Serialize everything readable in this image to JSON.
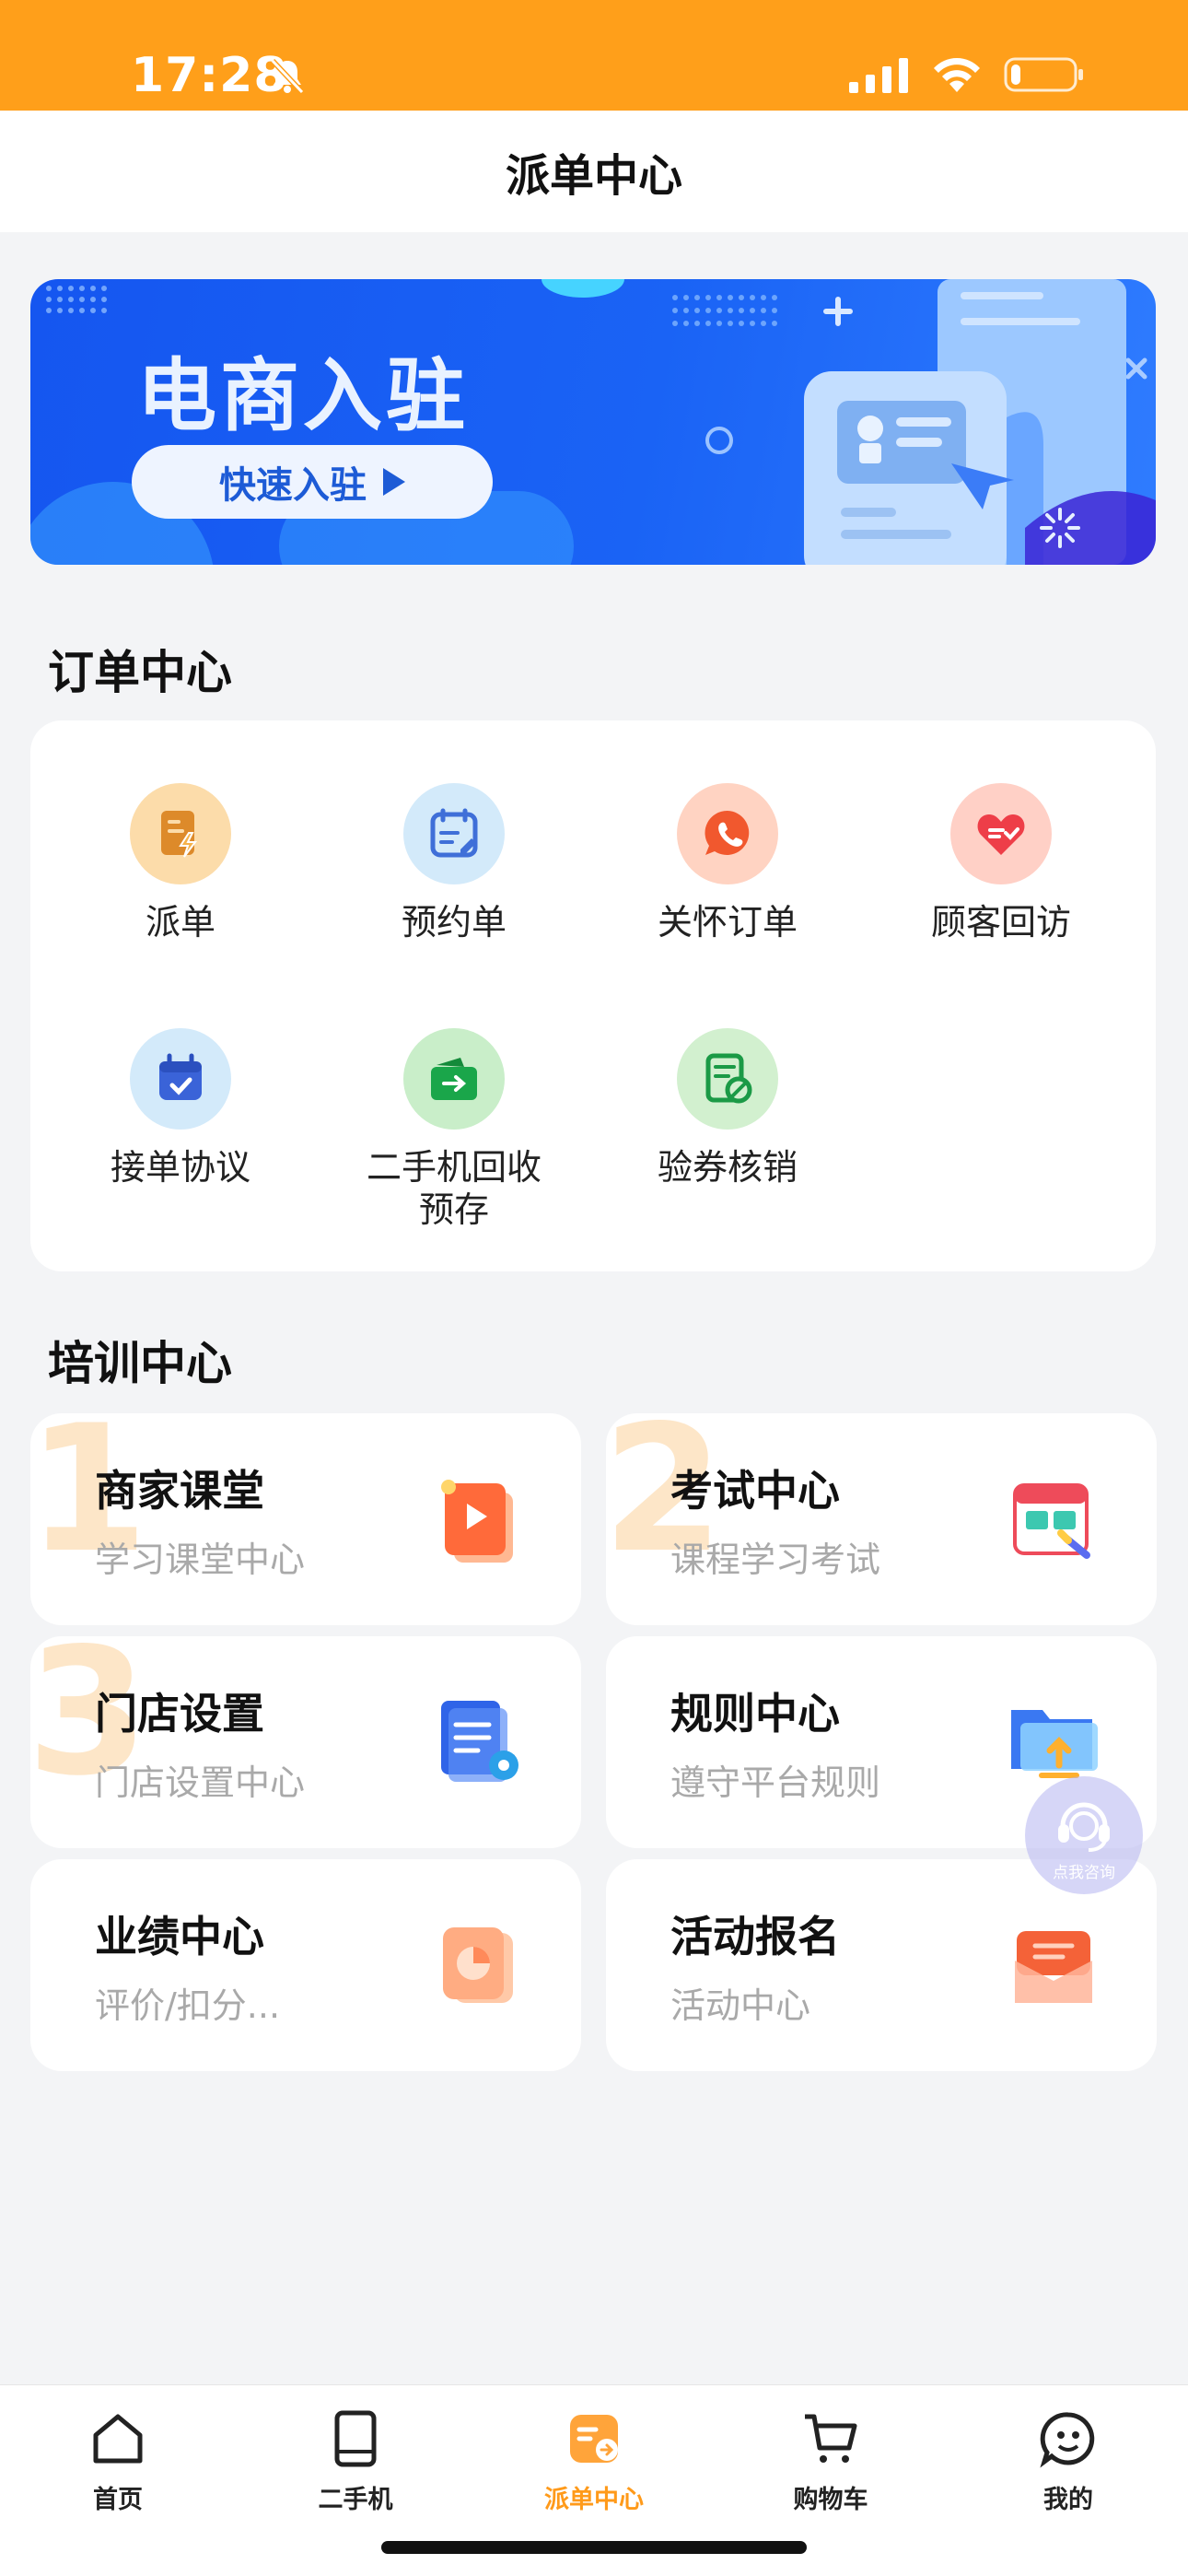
{
  "status_bar": {
    "time": "17:28",
    "battery_level": 0.15
  },
  "nav": {
    "title": "派单中心"
  },
  "banner": {
    "title": "电商入驻",
    "button_label": "快速入驻"
  },
  "order_center": {
    "title": "订单中心",
    "items": [
      {
        "label": "派单",
        "icon": "dispatch-icon",
        "color": "#fbd9a6"
      },
      {
        "label": "预约单",
        "icon": "appointment-calendar-icon",
        "color": "#d6ecfb"
      },
      {
        "label": "关怀订单",
        "icon": "phone-chat-icon",
        "color": "#ffd2c4"
      },
      {
        "label": "顾客回访",
        "icon": "heart-chat-icon",
        "color": "#ffd0c8"
      },
      {
        "label": "接单协议",
        "icon": "calendar-check-icon",
        "color": "#d6ecfb"
      },
      {
        "label": "二手机回收预存",
        "icon": "wallet-transfer-icon",
        "color": "#cdefcf"
      },
      {
        "label": "验券核销",
        "icon": "coupon-verify-icon",
        "color": "#d4f0d2"
      }
    ]
  },
  "training_center": {
    "title": "培训中心",
    "items": [
      {
        "number": "1",
        "title": "商家课堂",
        "subtitle": "学习课堂中心",
        "icon": "video-book-icon"
      },
      {
        "number": "2",
        "title": "考试中心",
        "subtitle": "课程学习考试",
        "icon": "exam-calendar-icon"
      },
      {
        "number": "3",
        "title": "门店设置",
        "subtitle": "门店设置中心",
        "icon": "document-gear-icon"
      },
      {
        "number": "",
        "title": "规则中心",
        "subtitle": "遵守平台规则",
        "icon": "folder-upload-icon"
      },
      {
        "number": "",
        "title": "业绩中心",
        "subtitle": "评价/扣分...",
        "icon": "pie-chart-icon"
      },
      {
        "number": "",
        "title": "活动报名",
        "subtitle": "活动中心",
        "icon": "envelope-icon"
      }
    ]
  },
  "consult": {
    "label": "点我咨询"
  },
  "tabs": [
    {
      "label": "首页",
      "icon": "home-icon",
      "active": false
    },
    {
      "label": "二手机",
      "icon": "tablet-icon",
      "active": false
    },
    {
      "label": "派单中心",
      "icon": "dispatch-tab-icon",
      "active": true
    },
    {
      "label": "购物车",
      "icon": "cart-icon",
      "active": false
    },
    {
      "label": "我的",
      "icon": "smile-icon",
      "active": false
    }
  ],
  "colors": {
    "status_bar": "#ff9f1a",
    "accent": "#ff9a1a",
    "banner": "#1a63f5"
  }
}
